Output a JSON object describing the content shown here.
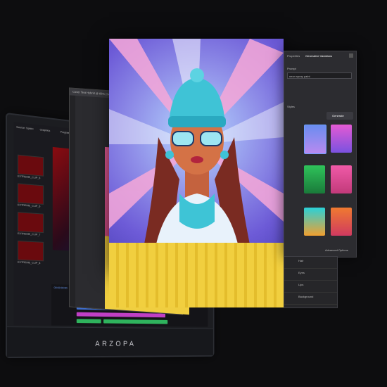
{
  "brand": "ARZOPA",
  "premiere": {
    "tabs": [
      "Source: Spider",
      "Graphics",
      "Program: Rough Cut"
    ],
    "timecode": "00:00:00:00",
    "bins": [
      {
        "label": "EXTREME_CLIP_5"
      },
      {
        "label": "EXTREME_CLIP_6"
      },
      {
        "label": "EXTREME_CLIP_7"
      },
      {
        "label": "EXTREME_CLIP_8"
      }
    ]
  },
  "photoshop": {
    "title": "Cover Text Hybrid @ 66% (Generative Fill)"
  },
  "generative_panel": {
    "tabs": [
      "Properties",
      "Generative Variations"
    ],
    "prompt_label": "Prompt",
    "prompt_value": "neon spray paint",
    "options_label": "Styles",
    "generate_label": "Generate",
    "advanced_label": "Advanced Options"
  },
  "layers": [
    "Hair",
    "Eyes",
    "Lips",
    "Background"
  ],
  "colors": {
    "accent": "#4a7fd8",
    "timeline_green": "#2fb35d",
    "timeline_magenta": "#c03fc5",
    "timeline_blue": "#3f6fd0"
  }
}
